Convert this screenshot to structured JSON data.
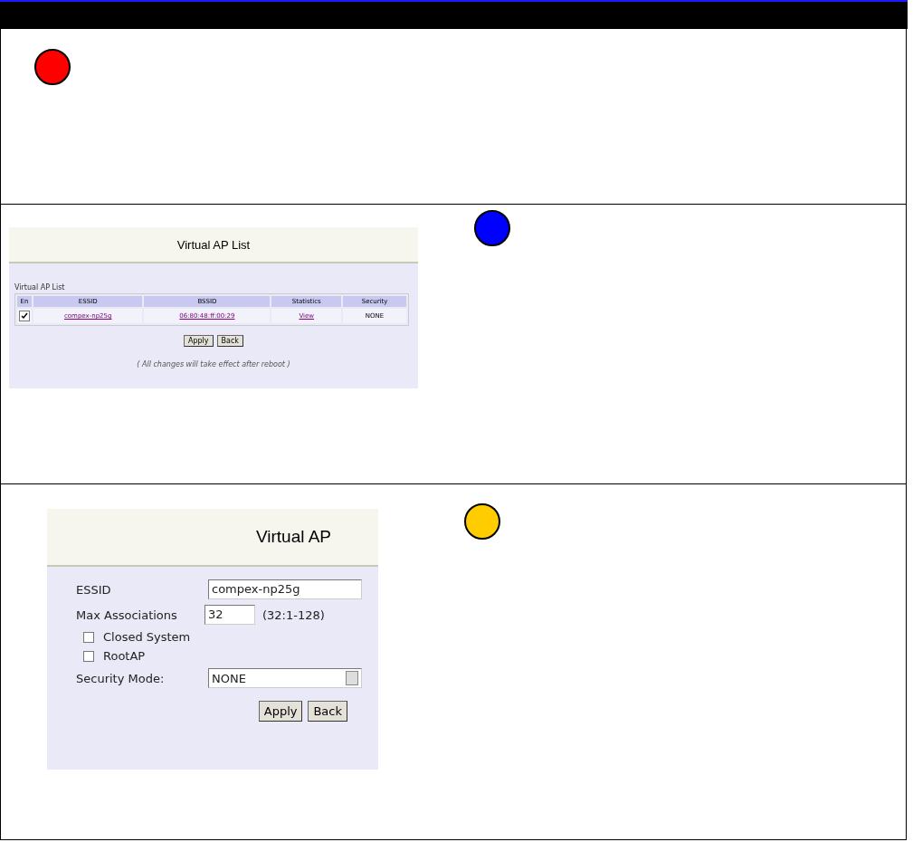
{
  "sections": [
    {
      "marker": {
        "color": "#ff0000"
      }
    },
    {
      "marker": {
        "color": "#0000ff"
      },
      "screenshot": {
        "kind": "list",
        "title": "Virtual AP List",
        "table_caption": "Virtual AP List",
        "columns": [
          "En",
          "ESSID",
          "BSSID",
          "Statistics",
          "Security"
        ],
        "rows": [
          {
            "enabled": true,
            "essid": "compex-np25g",
            "bssid": "06:80:48:ff:00:29",
            "statistics": "View",
            "security": "NONE"
          }
        ],
        "buttons": [
          "Apply",
          "Back"
        ],
        "note": "( All changes will take effect after reboot )"
      }
    },
    {
      "marker": {
        "color": "#ffcc00"
      },
      "screenshot": {
        "kind": "form",
        "title": "Virtual AP",
        "essid_label": "ESSID",
        "essid_value": "compex-np25g",
        "max_label": "Max Associations",
        "max_value": "32",
        "max_hint": "(32:1-128)",
        "checkboxes": [
          {
            "label": "Closed System",
            "checked": false
          },
          {
            "label": "RootAP",
            "checked": false
          }
        ],
        "security_label": "Security Mode:",
        "security_value": "NONE",
        "buttons": [
          "Apply",
          "Back"
        ]
      }
    }
  ]
}
